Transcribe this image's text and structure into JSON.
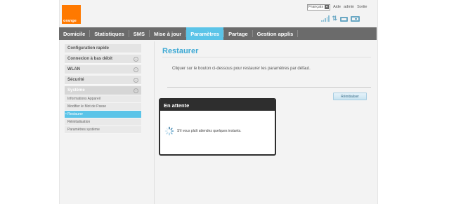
{
  "header": {
    "brand": "orange",
    "language": "Français",
    "help": "Aide",
    "user": "admin",
    "logout": "Sortie"
  },
  "nav": {
    "items": [
      {
        "label": "Domicile"
      },
      {
        "label": "Statistiques"
      },
      {
        "label": "SMS"
      },
      {
        "label": "Mise à jour"
      },
      {
        "label": "Paramètres",
        "active": true
      },
      {
        "label": "Partage"
      },
      {
        "label": "Gestion applis"
      }
    ]
  },
  "sidebar": {
    "sections": [
      {
        "label": "Configuration rapide"
      },
      {
        "label": "Connexion à bas débit"
      },
      {
        "label": "WLAN"
      },
      {
        "label": "Sécurité"
      },
      {
        "label": "Système",
        "open": true
      }
    ],
    "subitems": [
      {
        "label": "Informations Appareil"
      },
      {
        "label": "Modifier le Mot de Passe"
      },
      {
        "label": "• Restaurer",
        "active": true
      },
      {
        "label": "Réinitialisation"
      },
      {
        "label": "Paramètres système"
      }
    ]
  },
  "main": {
    "title": "Restaurer",
    "description": "Cliquer sur le bouton ci-dessous pour restaurer les paramètres par défaut.",
    "reset_button": "Réinitialiser"
  },
  "modal": {
    "title": "En attente",
    "message": "S'il vous plaît attendez quelques instants."
  },
  "colors": {
    "brand": "#ff7900",
    "accent": "#5bc4e8",
    "nav_bg": "#6b6b6b",
    "title": "#3da9d4"
  }
}
